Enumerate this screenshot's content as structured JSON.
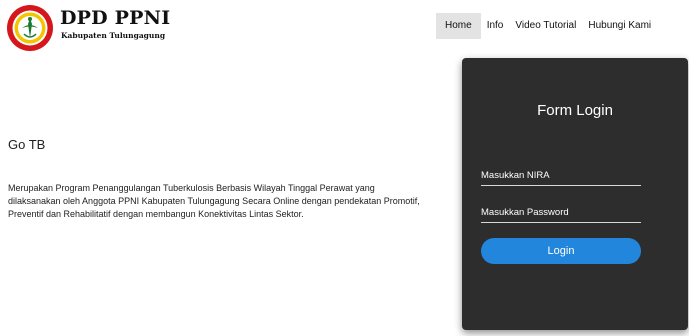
{
  "brand": {
    "title": "DPD PPNI",
    "subtitle": "Kabupaten Tulungagung",
    "logo_icon": "ppni-emblem-icon",
    "colors": {
      "ring": "#d5161b",
      "inner": "#f2c500",
      "emblem": "#1a7a32"
    }
  },
  "nav": {
    "items": [
      {
        "label": "Home",
        "active": true
      },
      {
        "label": "Info"
      },
      {
        "label": "Video Tutorial"
      },
      {
        "label": "Hubungi Kami"
      }
    ]
  },
  "main": {
    "headline": "Go TB",
    "description": "Merupakan Program Penanggulangan Tuberkulosis Berbasis Wilayah Tinggal Perawat yang dilaksanakan oleh Anggota PPNI Kabupaten Tulungagung Secara Online dengan pendekatan Promotif, Preventif dan Rehabilitatif dengan membangun Konektivitas Lintas Sektor."
  },
  "login": {
    "title": "Form Login",
    "nira_placeholder": "Masukkan NIRA",
    "password_placeholder": "Masukkan Password",
    "button_label": "Login",
    "panel_color": "#2d2d2d",
    "button_color": "#2286dd"
  }
}
